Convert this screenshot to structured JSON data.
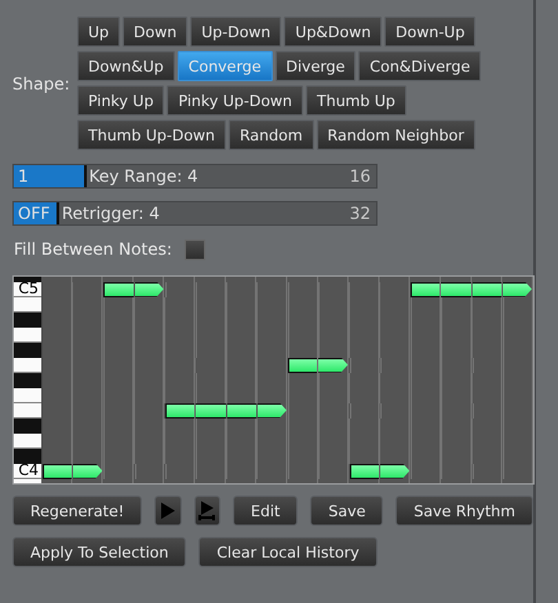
{
  "shape": {
    "label": "Shape:",
    "button_groups": [
      {
        "buttons": [
          {
            "label": "Up",
            "selected": false
          },
          {
            "label": "Down",
            "selected": false
          },
          {
            "label": "Up-Down",
            "selected": false
          },
          {
            "label": "Up&Down",
            "selected": false
          },
          {
            "label": "Down-Up",
            "selected": false
          }
        ]
      },
      {
        "buttons": [
          {
            "label": "Down&Up",
            "selected": false
          },
          {
            "label": "Converge",
            "selected": true
          },
          {
            "label": "Diverge",
            "selected": false
          },
          {
            "label": "Con&Diverge",
            "selected": false
          }
        ]
      },
      {
        "buttons": [
          {
            "label": "Pinky Up",
            "selected": false
          },
          {
            "label": "Pinky Up-Down",
            "selected": false
          },
          {
            "label": "Thumb Up",
            "selected": false
          }
        ]
      },
      {
        "buttons": [
          {
            "label": "Thumb Up-Down",
            "selected": false
          },
          {
            "label": "Random",
            "selected": false
          },
          {
            "label": "Random Neighbor",
            "selected": false
          }
        ]
      }
    ]
  },
  "sliders": [
    {
      "min": "1",
      "label": "Key Range: 4",
      "max": "16",
      "level": 0.2
    },
    {
      "min": "OFF",
      "label": "Retrigger: 4",
      "max": "32",
      "level": 0.125
    }
  ],
  "fill_between_notes": {
    "label": "Fill Between Notes:",
    "checked": false
  },
  "piano_roll": {
    "keys": [
      {
        "kind": "white",
        "label": "C5",
        "steps": [
          false,
          false,
          true,
          true,
          false,
          false,
          false,
          false,
          false,
          false,
          false,
          false,
          true,
          true,
          true,
          true
        ]
      },
      {
        "kind": "white",
        "steps": [
          false,
          false,
          false,
          false,
          false,
          false,
          false,
          false,
          false,
          false,
          false,
          false,
          false,
          false,
          false,
          false
        ]
      },
      {
        "kind": "black",
        "steps": [
          false,
          false,
          false,
          false,
          false,
          false,
          false,
          false,
          false,
          false,
          false,
          false,
          false,
          false,
          false,
          false
        ]
      },
      {
        "kind": "white",
        "steps": [
          false,
          false,
          false,
          false,
          false,
          false,
          false,
          false,
          false,
          false,
          false,
          false,
          false,
          false,
          false,
          false
        ]
      },
      {
        "kind": "black",
        "steps": [
          false,
          false,
          false,
          false,
          false,
          false,
          false,
          false,
          false,
          false,
          false,
          false,
          false,
          false,
          false,
          false
        ]
      },
      {
        "kind": "white",
        "steps": [
          false,
          false,
          false,
          false,
          false,
          false,
          false,
          false,
          true,
          true,
          false,
          false,
          false,
          false,
          false,
          false
        ]
      },
      {
        "kind": "black",
        "steps": [
          false,
          false,
          false,
          false,
          false,
          false,
          false,
          false,
          false,
          false,
          false,
          false,
          false,
          false,
          false,
          false
        ]
      },
      {
        "kind": "white",
        "steps": [
          false,
          false,
          false,
          false,
          false,
          false,
          false,
          false,
          false,
          false,
          false,
          false,
          false,
          false,
          false,
          false
        ]
      },
      {
        "kind": "white",
        "steps": [
          false,
          false,
          false,
          false,
          true,
          true,
          true,
          true,
          false,
          false,
          false,
          false,
          false,
          false,
          false,
          false
        ]
      },
      {
        "kind": "black",
        "steps": [
          false,
          false,
          false,
          false,
          false,
          false,
          false,
          false,
          false,
          false,
          false,
          false,
          false,
          false,
          false,
          false
        ]
      },
      {
        "kind": "white",
        "steps": [
          false,
          false,
          false,
          false,
          false,
          false,
          false,
          false,
          false,
          false,
          false,
          false,
          false,
          false,
          false,
          false
        ]
      },
      {
        "kind": "black",
        "steps": [
          false,
          false,
          false,
          false,
          false,
          false,
          false,
          false,
          false,
          false,
          false,
          false,
          false,
          false,
          false,
          false
        ]
      },
      {
        "kind": "white",
        "label": "C4",
        "steps": [
          true,
          true,
          false,
          false,
          false,
          false,
          false,
          false,
          false,
          false,
          true,
          true,
          false,
          false,
          false,
          false
        ]
      }
    ]
  },
  "actions": [
    {
      "buttons": [
        {
          "kind": "text",
          "label": "Regenerate!"
        },
        {
          "kind": "play"
        },
        {
          "kind": "play-bracket"
        },
        {
          "kind": "text",
          "label": "Edit"
        },
        {
          "kind": "text",
          "label": "Save"
        },
        {
          "kind": "text",
          "label": "Save Rhythm"
        }
      ]
    },
    {
      "buttons": [
        {
          "kind": "text",
          "label": "Apply To Selection"
        },
        {
          "kind": "text",
          "label": "Clear Local History"
        }
      ]
    }
  ]
}
